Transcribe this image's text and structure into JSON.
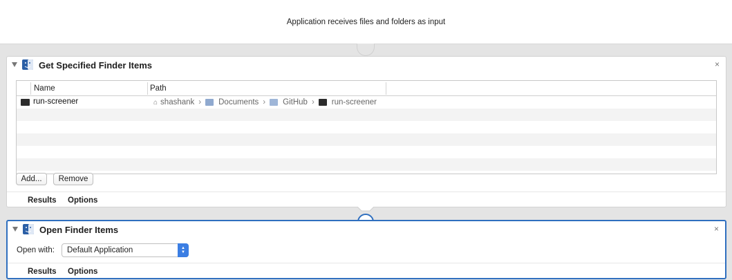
{
  "workflow": {
    "input_description": "Application receives files and folders as input"
  },
  "actions": [
    {
      "title": "Get Specified Finder Items",
      "close_glyph": "×",
      "table": {
        "columns": [
          "Name",
          "Path"
        ],
        "rows": [
          {
            "name": "run-screener",
            "path": [
              "shashank",
              "Documents",
              "GitHub",
              "run-screener"
            ]
          }
        ]
      },
      "buttons": {
        "add": "Add...",
        "remove": "Remove"
      },
      "footer_tabs": [
        "Results",
        "Options"
      ]
    },
    {
      "title": "Open Finder Items",
      "close_glyph": "×",
      "open_with_label": "Open with:",
      "open_with_value": "Default Application",
      "footer_tabs": [
        "Results",
        "Options"
      ]
    }
  ],
  "colors": {
    "selected_border": "#2f6fbf",
    "popup_accent": "#3b7ee3"
  },
  "path_separator": "›"
}
